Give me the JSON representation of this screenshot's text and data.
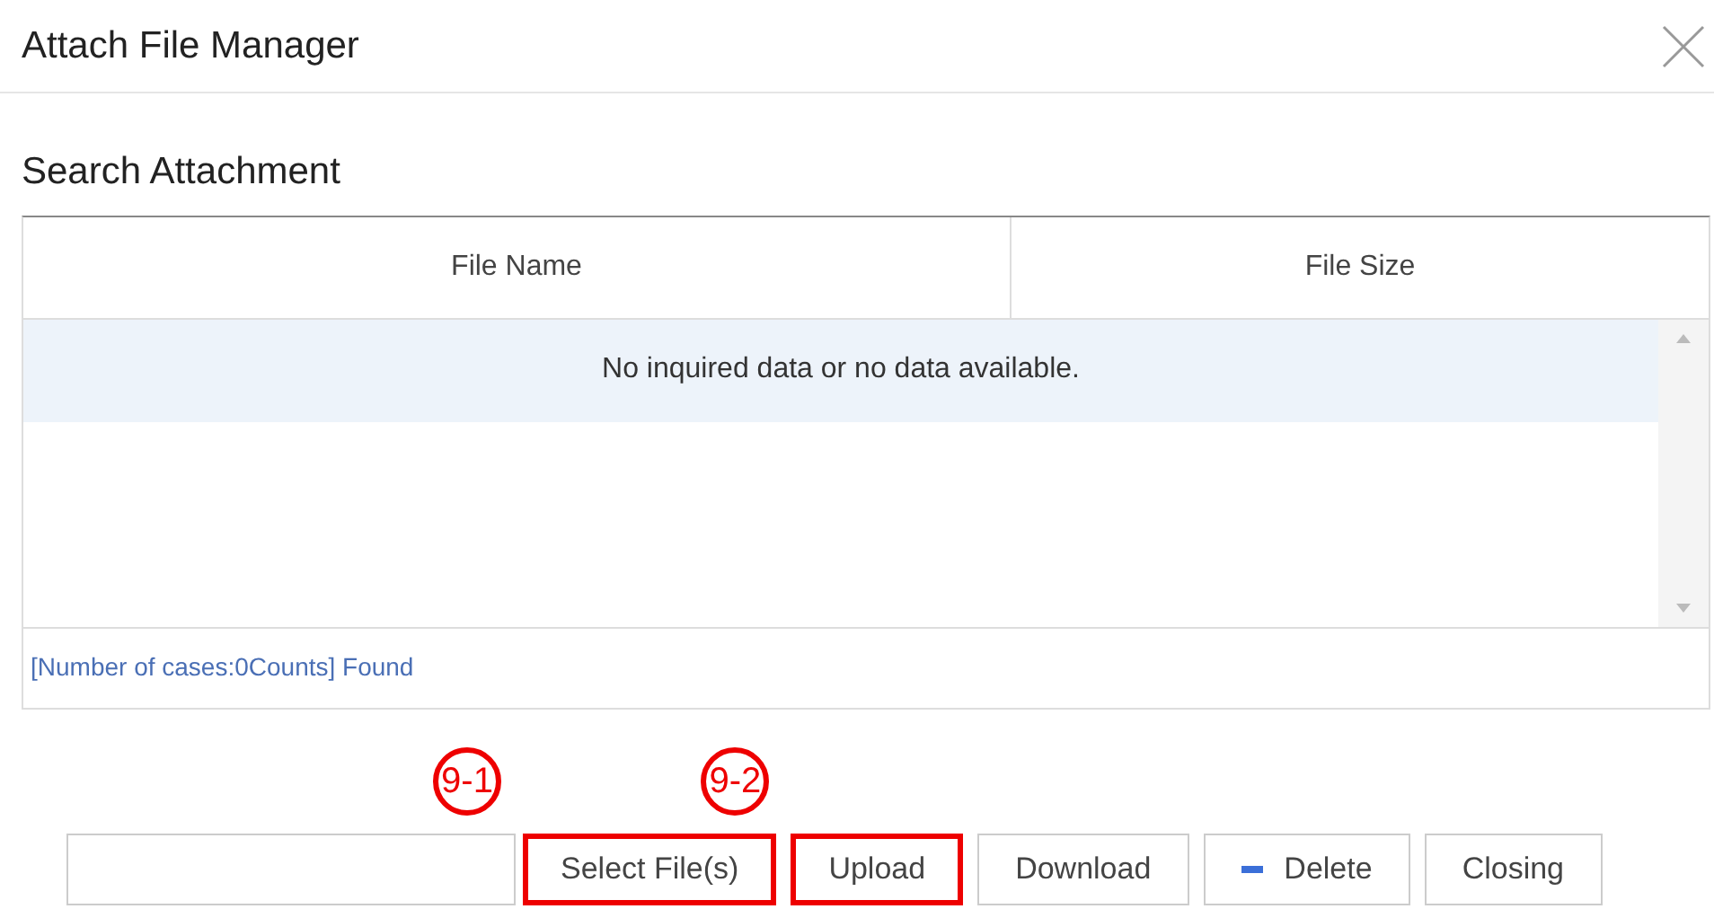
{
  "window": {
    "title": "Attach File Manager"
  },
  "section_title": "Search Attachment",
  "table": {
    "columns": [
      "File Name",
      "File Size"
    ],
    "empty_message": "No inquired data or no data available.",
    "footer": "[Number of cases:0Counts] Found"
  },
  "buttons": [
    {
      "kind": "plain",
      "label": "Select File(s)",
      "highlighted": true,
      "callout": "9-1"
    },
    {
      "kind": "plain",
      "label": "Upload",
      "highlighted": true,
      "callout": "9-2"
    },
    {
      "kind": "plain",
      "label": "Download",
      "highlighted": false
    },
    {
      "kind": "minus",
      "label": "Delete",
      "highlighted": false
    },
    {
      "kind": "plain",
      "label": "Closing",
      "highlighted": false
    }
  ]
}
